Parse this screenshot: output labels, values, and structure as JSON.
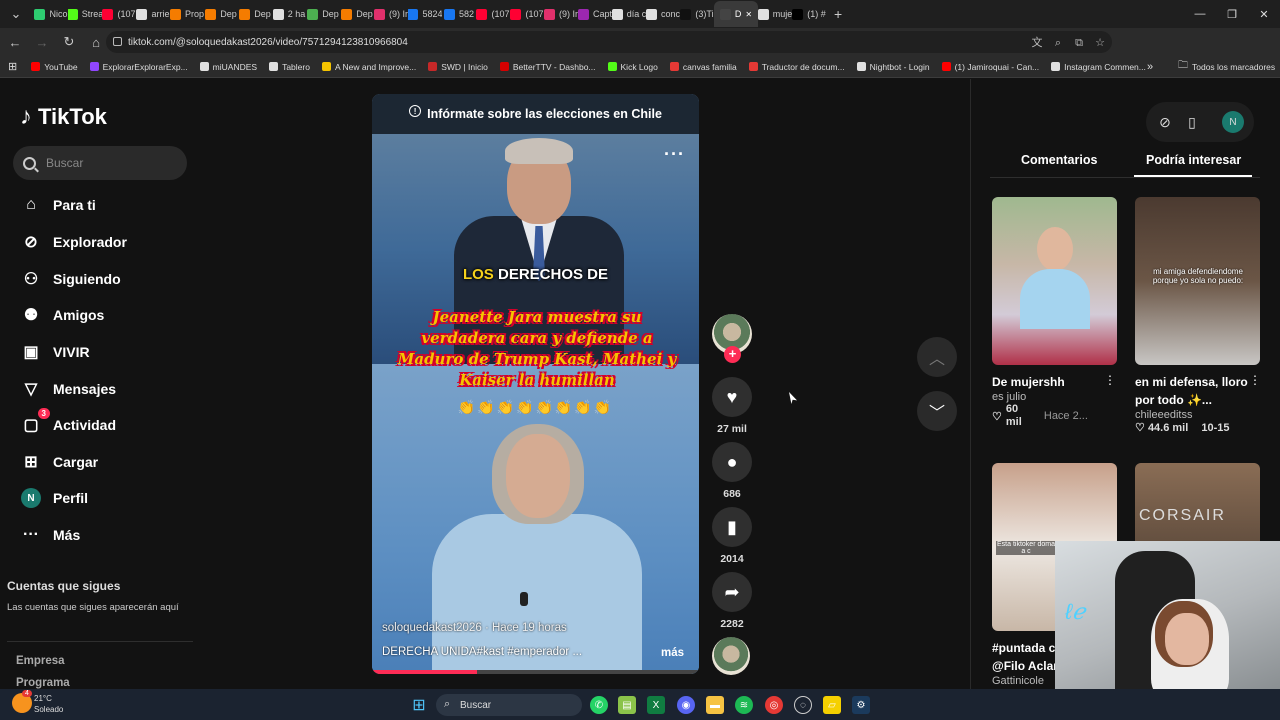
{
  "browser": {
    "tabs": [
      {
        "label": "Nico",
        "color": "#2ecc71"
      },
      {
        "label": "Strea",
        "color": "#53fc18"
      },
      {
        "label": "(107",
        "color": "#ff0033"
      },
      {
        "label": "arrie",
        "color": "#e0e0e0"
      },
      {
        "label": "Prop",
        "color": "#f57c00"
      },
      {
        "label": "Dep",
        "color": "#f57c00"
      },
      {
        "label": "Dep",
        "color": "#f57c00"
      },
      {
        "label": "2 ha",
        "color": "#e0e0e0"
      },
      {
        "label": "Dep",
        "color": "#4caf50"
      },
      {
        "label": "Dep",
        "color": "#f57c00"
      },
      {
        "label": "(9) Ir",
        "color": "#e1306c"
      },
      {
        "label": "5824",
        "color": "#1877f2"
      },
      {
        "label": "582",
        "color": "#1877f2"
      },
      {
        "label": "(107",
        "color": "#ff0033"
      },
      {
        "label": "(107",
        "color": "#ff0033"
      },
      {
        "label": "(9) Ir",
        "color": "#e1306c"
      },
      {
        "label": "Capt",
        "color": "#9c27b0"
      },
      {
        "label": "día c",
        "color": "#e0e0e0"
      },
      {
        "label": "conc",
        "color": "#e0e0e0"
      },
      {
        "label": "(3)Ti",
        "color": "#111111"
      },
      {
        "label": "D",
        "color": "#444444",
        "active": true
      },
      {
        "label": "muje",
        "color": "#e0e0e0"
      },
      {
        "label": "(1) #",
        "color": "#000000"
      }
    ],
    "new_tab": "+",
    "url": "tiktok.com/@soloquedakast2026/video/7571294123810966804",
    "bookmarks": [
      {
        "label": "YouTube",
        "color": "#ff0000"
      },
      {
        "label": "ExplorarExplorarExp...",
        "color": "#9146ff"
      },
      {
        "label": "miUANDES",
        "color": "#e0e0e0"
      },
      {
        "label": "Tablero",
        "color": "#e0e0e0"
      },
      {
        "label": "A New and Improve...",
        "color": "#f5c400"
      },
      {
        "label": "SWD | Inicio",
        "color": "#c62828"
      },
      {
        "label": "BetterTTV - Dashbo...",
        "color": "#d50000"
      },
      {
        "label": "Kick Logo",
        "color": "#53fc18"
      },
      {
        "label": "canvas familia",
        "color": "#e53935"
      },
      {
        "label": "Traductor de docum...",
        "color": "#e53935"
      },
      {
        "label": "Nightbot - Login",
        "color": "#e0e0e0"
      },
      {
        "label": "(1) Jamiroquai - Can...",
        "color": "#ff0000"
      },
      {
        "label": "Instagram Commen...",
        "color": "#e0e0e0"
      }
    ],
    "all_bookmarks": "Todos los marcadores"
  },
  "sidebar": {
    "logo": "TikTok",
    "search_placeholder": "Buscar",
    "items": [
      {
        "label": "Para ti",
        "icon": "home-icon"
      },
      {
        "label": "Explorador",
        "icon": "compass-icon"
      },
      {
        "label": "Siguiendo",
        "icon": "following-icon"
      },
      {
        "label": "Amigos",
        "icon": "friends-icon"
      },
      {
        "label": "VIVIR",
        "icon": "live-icon"
      },
      {
        "label": "Mensajes",
        "icon": "send-icon"
      },
      {
        "label": "Actividad",
        "icon": "inbox-icon",
        "badge": "3"
      },
      {
        "label": "Cargar",
        "icon": "upload-icon"
      },
      {
        "label": "Perfil",
        "icon": "profile-icon",
        "avatar": "N"
      },
      {
        "label": "Más",
        "icon": "more-icon"
      }
    ],
    "following_title": "Cuentas que sigues",
    "following_desc": "Las cuentas que sigues aparecerán aquí",
    "footer": [
      "Empresa",
      "Programa"
    ]
  },
  "video": {
    "banner": "Infórmate sobre las elecciones en Chile",
    "caption_top_yellow": "LOS",
    "caption_top_white": "DERECHOS DE",
    "caption_main": "Jeanette Jara muestra su verdadera cara y defiende a Maduro de Trump Kast, Mathei y Kaiser la humillan",
    "emojis": "👏👏👏👏👏👏👏👏",
    "user_line": "soloquedakast2026 · Hace 19 horas",
    "description": "DERECHA UNIDA#kast  #emperador  ...",
    "more": "más",
    "progress": 0.32
  },
  "actions": {
    "likes": "27 mil",
    "comments": "686",
    "saves": "2014",
    "shares": "2282"
  },
  "right_panel": {
    "profile_initial": "N",
    "tabs": [
      "Comentarios",
      "Podría interesar"
    ],
    "active_tab": "Podría interesar",
    "cards": [
      {
        "title": "De mujershh",
        "author": "es julio",
        "likes": "60 mil",
        "time": "Hace 2...",
        "overlay": ""
      },
      {
        "title": "en mi defensa, lloro por todo ✨...",
        "author": "chileeeditss",
        "likes": "44.6 mil",
        "time": "10-15",
        "overlay": "mi amiga defendiendome porque yo sola no puedo:"
      },
      {
        "title": "#puntada c",
        "author": "Gattinicole",
        "likes": "",
        "time": "",
        "overlay": "Esta tiktoker doma a c"
      },
      {
        "title": "@Filo Aclar",
        "author": "",
        "likes": "",
        "time": "",
        "overlay": "CORSAIR"
      }
    ]
  },
  "taskbar": {
    "weather_temp": "21°C",
    "weather_desc": "Soleado",
    "weather_badge": "4",
    "search": "Buscar"
  }
}
